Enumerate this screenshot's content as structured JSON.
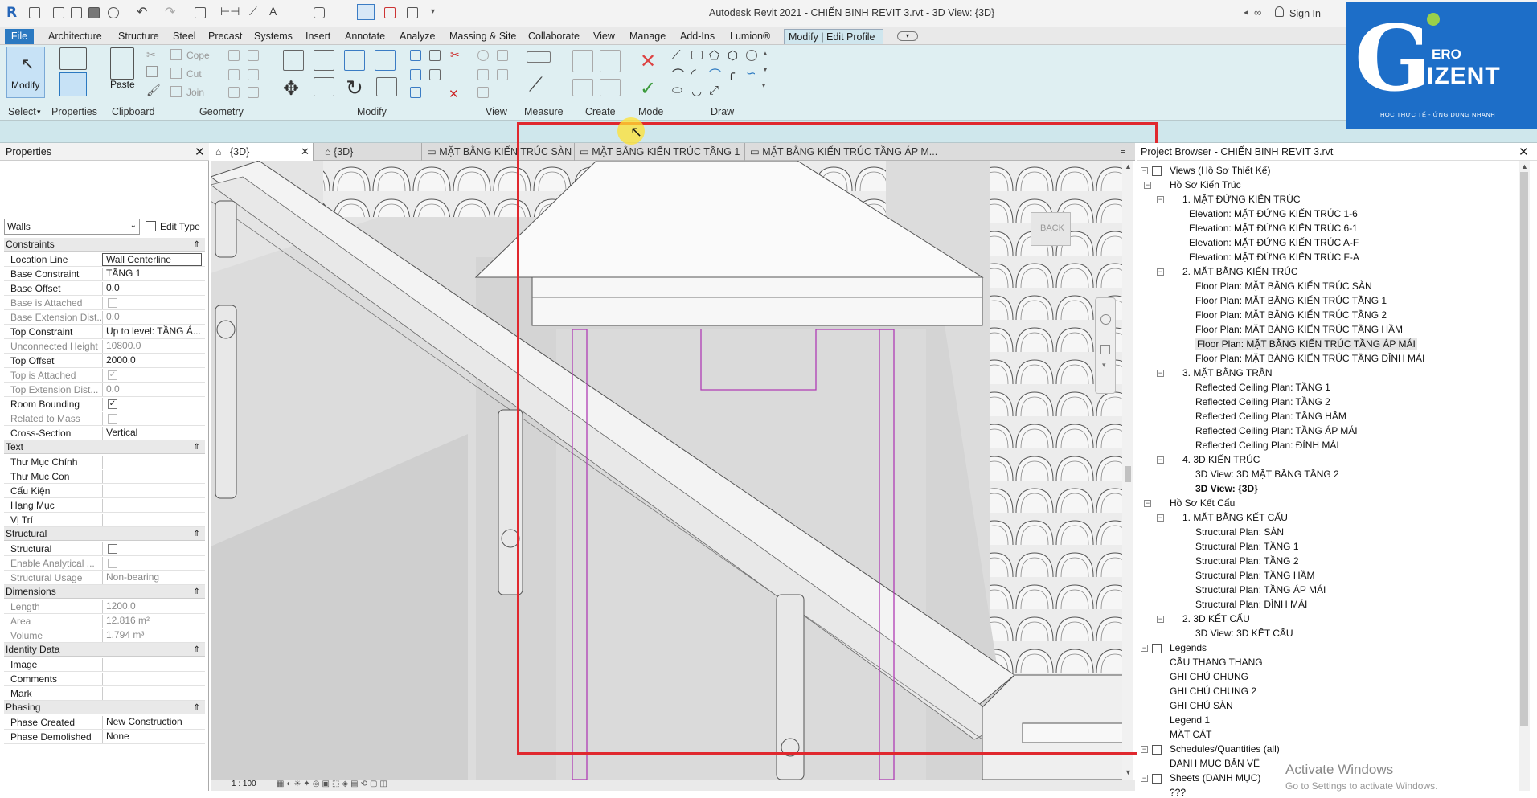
{
  "title_bar": {
    "title": "Autodesk Revit 2021 - CHIẾN BINH REVIT 3.rvt - 3D View: {3D}",
    "sign_in": "Sign In"
  },
  "ribbon_tabs": [
    "File",
    "Architecture",
    "Structure",
    "Steel",
    "Precast",
    "Systems",
    "Insert",
    "Annotate",
    "Analyze",
    "Massing & Site",
    "Collaborate",
    "View",
    "Manage",
    "Add-Ins",
    "Lumion®",
    "Modify | Edit Profile"
  ],
  "ribbon": {
    "modify_label": "Modify",
    "paste_label": "Paste",
    "cope": "Cope",
    "cut": "Cut",
    "join": "Join",
    "panels": [
      "Select",
      "Properties",
      "Clipboard",
      "Geometry",
      "Modify",
      "View",
      "Measure",
      "Create",
      "Mode",
      "Draw"
    ]
  },
  "logo": {
    "text_top": "ERO",
    "text_main": "IZENT",
    "slogan": "HỌC THỰC TẾ - ỨNG DỤNG NHANH"
  },
  "properties": {
    "title": "Properties",
    "type": "Walls",
    "edit_type": "Edit Type",
    "sections": [
      {
        "name": "Constraints",
        "rows": [
          {
            "k": "Location Line",
            "v": "Wall Centerline",
            "dim": false
          },
          {
            "k": "Base Constraint",
            "v": "TẦNG 1",
            "dim": false
          },
          {
            "k": "Base Offset",
            "v": "0.0",
            "dim": false
          },
          {
            "k": "Base is Attached",
            "v": "",
            "dim": true,
            "check": "off"
          },
          {
            "k": "Base Extension Dist...",
            "v": "0.0",
            "dim": true
          },
          {
            "k": "Top Constraint",
            "v": "Up to level: TẦNG Á...",
            "dim": false
          },
          {
            "k": "Unconnected Height",
            "v": "10800.0",
            "dim": true
          },
          {
            "k": "Top Offset",
            "v": "2000.0",
            "dim": false
          },
          {
            "k": "Top is Attached",
            "v": "",
            "dim": true,
            "check": "on"
          },
          {
            "k": "Top Extension Dist...",
            "v": "0.0",
            "dim": true
          },
          {
            "k": "Room Bounding",
            "v": "",
            "dim": false,
            "check": "on"
          },
          {
            "k": "Related to Mass",
            "v": "",
            "dim": true,
            "check": "off"
          },
          {
            "k": "Cross-Section",
            "v": "Vertical",
            "dim": false
          }
        ]
      },
      {
        "name": "Text",
        "rows": [
          {
            "k": "Thư Mục Chính",
            "v": "",
            "dim": false
          },
          {
            "k": "Thư Mục Con",
            "v": "",
            "dim": false
          },
          {
            "k": "Cấu Kiện",
            "v": "",
            "dim": false
          },
          {
            "k": "Hạng Mục",
            "v": "",
            "dim": false
          },
          {
            "k": "Vị Trí",
            "v": "",
            "dim": false
          }
        ]
      },
      {
        "name": "Structural",
        "rows": [
          {
            "k": "Structural",
            "v": "",
            "dim": false,
            "check": "off"
          },
          {
            "k": "Enable Analytical ...",
            "v": "",
            "dim": true,
            "check": "off"
          },
          {
            "k": "Structural Usage",
            "v": "Non-bearing",
            "dim": true
          }
        ]
      },
      {
        "name": "Dimensions",
        "rows": [
          {
            "k": "Length",
            "v": "1200.0",
            "dim": true
          },
          {
            "k": "Area",
            "v": "12.816 m²",
            "dim": true
          },
          {
            "k": "Volume",
            "v": "1.794 m³",
            "dim": true
          }
        ]
      },
      {
        "name": "Identity Data",
        "rows": [
          {
            "k": "Image",
            "v": "",
            "dim": false
          },
          {
            "k": "Comments",
            "v": "",
            "dim": false
          },
          {
            "k": "Mark",
            "v": "",
            "dim": false
          }
        ]
      },
      {
        "name": "Phasing",
        "rows": [
          {
            "k": "Phase Created",
            "v": "New Construction",
            "dim": false
          },
          {
            "k": "Phase Demolished",
            "v": "None",
            "dim": false
          }
        ]
      }
    ]
  },
  "view_tabs": [
    "{3D}",
    "{3D}",
    "MẶT BẰNG KIẾN TRÚC SÀN",
    "MẶT BẰNG KIẾN TRÚC TẦNG 1",
    "MẶT BẰNG KIẾN TRÚC TẦNG ÁP M..."
  ],
  "canvas": {
    "back_label": "BACK",
    "scale": "1 : 100"
  },
  "project_browser": {
    "title": "Project Browser - CHIẾN BINH REVIT 3.rvt",
    "items": [
      {
        "t": "Views (Hồ Sơ Thiết Kế)",
        "lvl": 0,
        "tog": "−"
      },
      {
        "t": "Hồ Sơ Kiến Trúc",
        "lvl": 1,
        "tog": "−"
      },
      {
        "t": "1. MẶT ĐỨNG KIẾN TRÚC",
        "lvl": 2,
        "tog": "−"
      },
      {
        "t": "Elevation: MẶT ĐỨNG KIẾN TRÚC 1-6",
        "lvl": 3
      },
      {
        "t": "Elevation: MẶT ĐỨNG KIẾN TRÚC 6-1",
        "lvl": 3
      },
      {
        "t": "Elevation: MẶT ĐỨNG KIẾN TRÚC A-F",
        "lvl": 3
      },
      {
        "t": "Elevation: MẶT ĐỨNG KIẾN TRÚC F-A",
        "lvl": 3
      },
      {
        "t": "2. MẶT BẰNG KIẾN TRÚC",
        "lvl": 2,
        "tog": "−"
      },
      {
        "t": "Floor Plan: MẶT BẰNG KIẾN TRÚC SÀN",
        "lvl": 4
      },
      {
        "t": "Floor Plan: MẶT BẰNG KIẾN TRÚC TẦNG 1",
        "lvl": 4
      },
      {
        "t": "Floor Plan: MẶT BẰNG KIẾN TRÚC TẦNG 2",
        "lvl": 4
      },
      {
        "t": "Floor Plan: MẶT BẰNG KIẾN TRÚC TẦNG HẦM",
        "lvl": 4
      },
      {
        "t": "Floor Plan: MẶT BẰNG KIẾN TRÚC TẦNG ÁP MÁI",
        "lvl": 4,
        "sel": true
      },
      {
        "t": "Floor Plan: MẶT BẰNG KIẾN TRÚC TẦNG ĐỈNH MÁI",
        "lvl": 4
      },
      {
        "t": "3. MẶT BẰNG TRẦN",
        "lvl": 2,
        "tog": "−"
      },
      {
        "t": "Reflected Ceiling Plan: TẦNG 1",
        "lvl": 4
      },
      {
        "t": "Reflected Ceiling Plan: TẦNG 2",
        "lvl": 4
      },
      {
        "t": "Reflected Ceiling Plan: TẦNG HẦM",
        "lvl": 4
      },
      {
        "t": "Reflected Ceiling Plan: TẦNG ÁP MÁI",
        "lvl": 4
      },
      {
        "t": "Reflected Ceiling Plan: ĐỈNH MÁI",
        "lvl": 4
      },
      {
        "t": "4. 3D KIẾN TRÚC",
        "lvl": 2,
        "tog": "−"
      },
      {
        "t": "3D View: 3D MẶT BẰNG TẦNG 2",
        "lvl": 4
      },
      {
        "t": "3D View: {3D}",
        "lvl": 4,
        "bold": true
      },
      {
        "t": "Hồ Sơ Kết Cấu",
        "lvl": 1,
        "tog": "−"
      },
      {
        "t": "1. MẶT BẰNG KẾT CẤU",
        "lvl": 2,
        "tog": "−"
      },
      {
        "t": "Structural Plan: SÀN",
        "lvl": 4
      },
      {
        "t": "Structural Plan: TẦNG 1",
        "lvl": 4
      },
      {
        "t": "Structural Plan: TẦNG 2",
        "lvl": 4
      },
      {
        "t": "Structural Plan: TẦNG HẦM",
        "lvl": 4
      },
      {
        "t": "Structural Plan: TẦNG ÁP MÁI",
        "lvl": 4
      },
      {
        "t": "Structural Plan: ĐỈNH MÁI",
        "lvl": 4
      },
      {
        "t": "2. 3D KẾT CẤU",
        "lvl": 2,
        "tog": "−"
      },
      {
        "t": "3D View: 3D KẾT CẤU",
        "lvl": 4
      },
      {
        "t": "Legends",
        "lvl": 0,
        "tog": "−"
      },
      {
        "t": "CẦU THANG THANG",
        "lvl": 5
      },
      {
        "t": "GHI CHÚ CHUNG",
        "lvl": 5
      },
      {
        "t": "GHI CHÚ CHUNG 2",
        "lvl": 5
      },
      {
        "t": "GHI CHÚ SÀN",
        "lvl": 5
      },
      {
        "t": "Legend 1",
        "lvl": 5
      },
      {
        "t": "MẶT CẮT",
        "lvl": 5
      },
      {
        "t": "Schedules/Quantities (all)",
        "lvl": 0,
        "tog": "−"
      },
      {
        "t": "DANH MỤC BẢN VẼ",
        "lvl": 5
      },
      {
        "t": "Sheets (DANH MỤC)",
        "lvl": 0,
        "tog": "−"
      },
      {
        "t": "???",
        "lvl": 5
      }
    ]
  },
  "watermark": {
    "line1": "Activate Windows",
    "line2": "Go to Settings to activate Windows."
  }
}
